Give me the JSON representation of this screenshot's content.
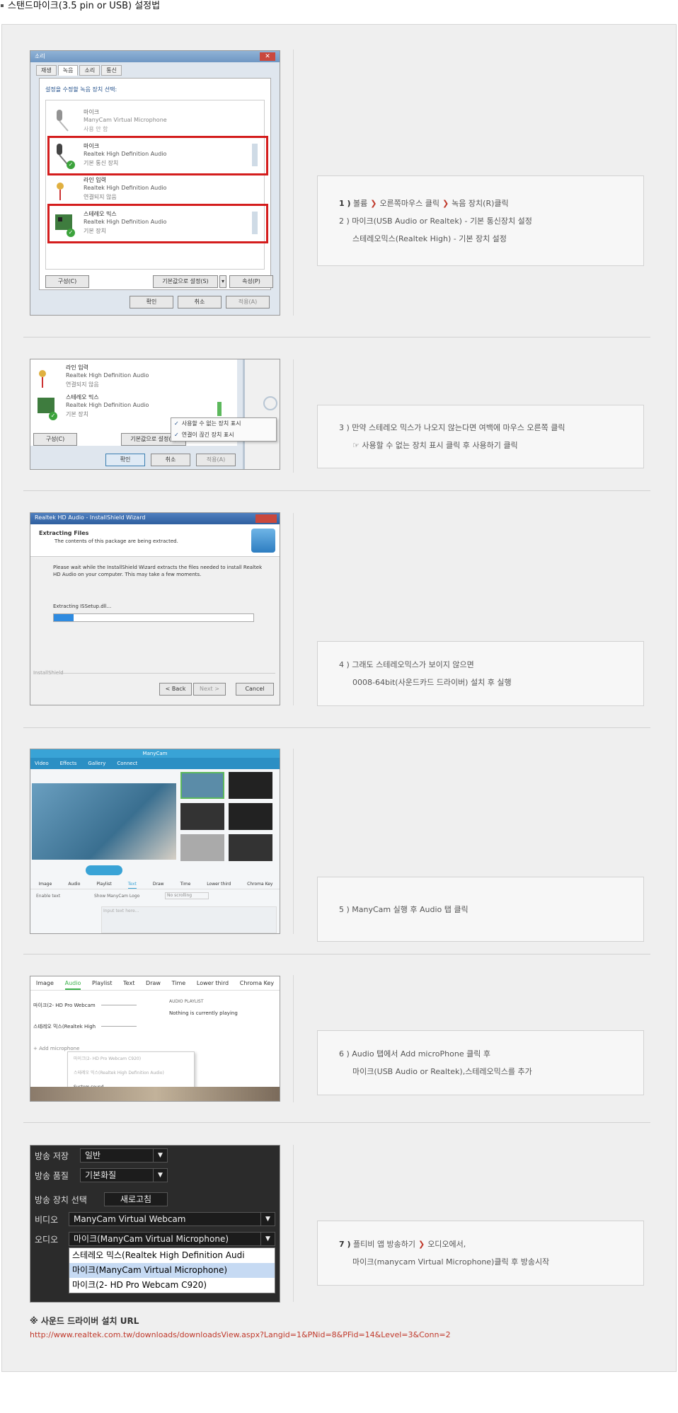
{
  "page_title": "스탠드마이크(3.5 pin or USB) 설정법",
  "steps": [
    {
      "num": "1 )",
      "line1_parts": [
        "볼륨",
        "오른쪽마우스 클릭",
        "녹음 장치(R)클릭"
      ],
      "line2": "2 ) 마이크(USB Audio or Realtek) - 기본 통신장치 설정",
      "line3": "스테레오믹스(Realtek High) - 기본 장치 설정"
    },
    {
      "line1": "3 ) 만약 스테레오 믹스가 나오지 않는다면 여백에 마우스 오른쪽 클릭",
      "line2": "☞ 사용할 수 없는 장치 표시 클릭 후 사용하기 클릭"
    },
    {
      "line1": "4 ) 그래도 스테레오믹스가 보이지 않으면",
      "line2": "0008-64bit(사운드카드 드라이버) 설치 후 실행"
    },
    {
      "line1": "5 ) ManyCam 실행 후 Audio 탭 클릭"
    },
    {
      "line1": "6 ) Audio 탭에서 Add microPhone 클릭 후",
      "line2": "마이크(USB Audio or Realtek),스테레오믹스를 추가"
    },
    {
      "num": "7 )",
      "line1_parts": [
        "플티비 앱 방송하기",
        "오디오에서,"
      ],
      "line2": "마이크(manycam Virtual Microphone)클릭 후 방송시작"
    }
  ],
  "shot1": {
    "title": "소리",
    "tabs": [
      "재생",
      "녹음",
      "소리",
      "통신"
    ],
    "instruction": "설정을 수정할 녹음 장치 선택:",
    "devices": [
      {
        "name": "마이크",
        "desc": "ManyCam Virtual Microphone",
        "status": "사용 안 함"
      },
      {
        "name": "마이크",
        "desc": "Realtek High Definition Audio",
        "status": "기본 통신 장치"
      },
      {
        "name": "라인 입력",
        "desc": "Realtek High Definition Audio",
        "status": "연결되지 않음"
      },
      {
        "name": "스테레오 믹스",
        "desc": "Realtek High Definition Audio",
        "status": "기본 장치"
      }
    ],
    "configure": "구성(C)",
    "set_default": "기본값으로 설정(S)",
    "properties": "속성(P)",
    "ok": "확인",
    "cancel": "취소",
    "apply": "적용(A)"
  },
  "shot2": {
    "devices": [
      {
        "name": "라인 입력",
        "desc": "Realtek High Definition Audio",
        "status": "연결되지 않음"
      },
      {
        "name": "스테레오 믹스",
        "desc": "Realtek High Definition Audio",
        "status": "기본 장치"
      }
    ],
    "menu": [
      "사용할 수 없는 장치 표시",
      "연결이 끊긴 장치 표시"
    ],
    "configure": "구성(C)",
    "set_default": "기본값으로 설정(S)",
    "ok": "확인",
    "cancel": "취소",
    "apply": "적용(A)"
  },
  "shot3": {
    "title": "Realtek HD Audio - InstallShield Wizard",
    "heading": "Extracting Files",
    "sub": "The contents of this package are being extracted.",
    "body": "Please wait while the InstallShield Wizard extracts the files needed to install Realtek HD Audio on your computer. This may take a few moments.",
    "extracting": "Extracting ISSetup.dll...",
    "progress": 0.1,
    "brand": "InstallShield",
    "back": "< Back",
    "next": "Next >",
    "cancel": "Cancel"
  },
  "shot4": {
    "title": "ManyCam",
    "tabs": [
      "Video",
      "Effects",
      "Gallery",
      "Connect"
    ],
    "bottom_tabs": [
      "Image",
      "Audio",
      "Playlist",
      "Text",
      "Draw",
      "Time",
      "Lower third",
      "Chroma Key"
    ],
    "enable_text": "Enable text",
    "show_logo": "Show ManyCam Logo",
    "scrolling": "No scrolling",
    "input_placeholder": "Input text here..."
  },
  "shot5": {
    "tabs": [
      "Image",
      "Audio",
      "Playlist",
      "Text",
      "Draw",
      "Time",
      "Lower third",
      "Chroma Key"
    ],
    "rows": [
      "마이크(2- HD Pro Webcam",
      "스테레오 믹스(Realtek High"
    ],
    "playlist_title": "AUDIO PLAYLIST",
    "playlist_empty": "Nothing is currently playing",
    "add_mic": "Add microphone",
    "popup": [
      "마이크(2- HD Pro Webcam C920)",
      "스테레오 믹스(Realtek High Definition Audio)",
      "System sound"
    ]
  },
  "shot6": {
    "labels": [
      "방송 저장",
      "방송 품질",
      "방송 장치 선택",
      "비디오",
      "오디오"
    ],
    "save_value": "일반",
    "quality_value": "기본화질",
    "refresh": "새로고침",
    "video_value": "ManyCam Virtual Webcam",
    "audio_value": "마이크(ManyCam Virtual Microphone)",
    "audio_options": [
      "스테레오 믹스(Realtek High Definition Audi",
      "마이크(ManyCam Virtual Microphone)",
      "마이크(2- HD Pro Webcam C920)"
    ]
  },
  "note_title": "※ 사운드 드라이버 설치 URL",
  "note_url": "http://www.realtek.com.tw/downloads/downloadsView.aspx?Langid=1&PNid=8&PFid=14&Level=3&Conn=2"
}
